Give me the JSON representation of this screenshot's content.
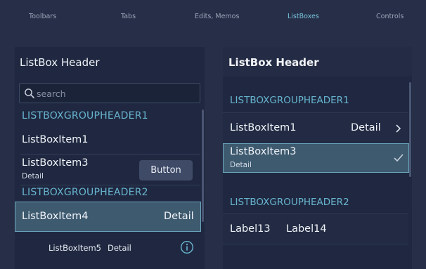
{
  "nav": {
    "tabs": [
      {
        "label": "Toolbars"
      },
      {
        "label": "Tabs"
      },
      {
        "label": "Edits, Memos"
      },
      {
        "label": "ListBoxes"
      },
      {
        "label": "Controls"
      }
    ],
    "active": "ListBoxes"
  },
  "left": {
    "header": "ListBox Header",
    "search_placeholder": "search",
    "group1": "LISTBOXGROUPHEADER1",
    "item1": {
      "title": "ListBoxItem1"
    },
    "item3": {
      "title": "ListBoxItem3",
      "detail": "Detail",
      "button": "Button"
    },
    "group2": "LISTBOXGROUPHEADER2",
    "item4": {
      "title": "ListBoxItem4",
      "detail": "Detail",
      "selected": true
    },
    "item5": {
      "title": "ListBoxItem5",
      "detail": "Detail",
      "icon": "info-icon"
    }
  },
  "right": {
    "header": "ListBox Header",
    "group1": "LISTBOXGROUPHEADER1",
    "item1": {
      "title": "ListBoxItem1",
      "detail": "Detail",
      "icon": "chevron-right-icon"
    },
    "item3": {
      "title": "ListBoxItem3",
      "detail": "Detail",
      "icon": "checkmark-icon",
      "selected": true
    },
    "group2": "LISTBOXGROUPHEADER2",
    "labels": [
      "Label13",
      "Label14"
    ]
  },
  "colors": {
    "background": "#262f47",
    "panel": "#1f2840",
    "accent": "#68b4cf",
    "selection": "#3e5a6f",
    "selection_border": "#6aa6bd"
  }
}
